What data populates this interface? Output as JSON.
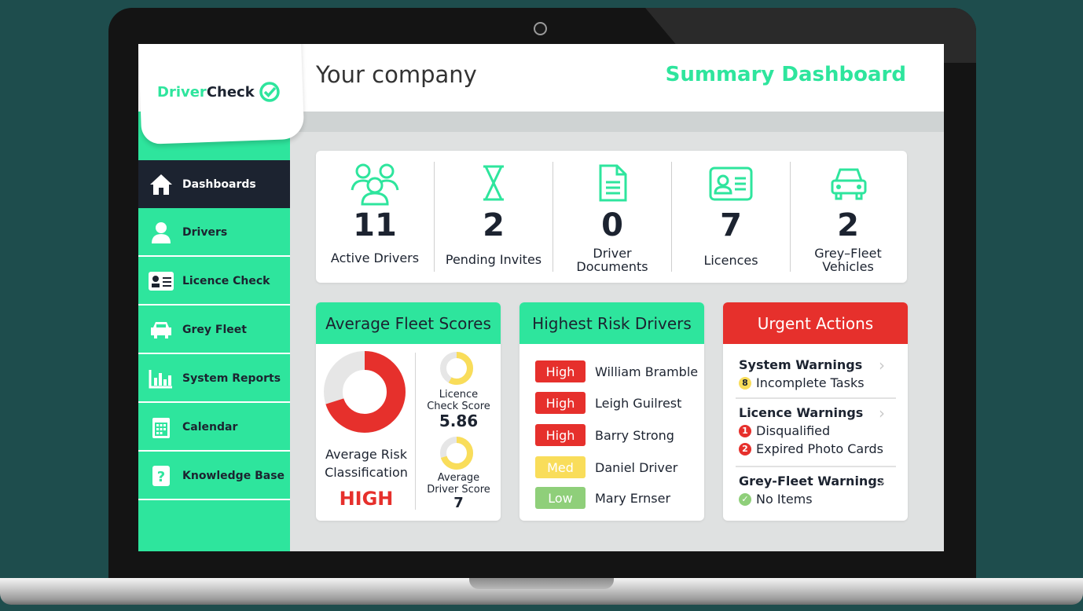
{
  "header": {
    "company": "Your company",
    "dashboard_title": "Summary Dashboard"
  },
  "brand": {
    "logo_part1": "Driver",
    "logo_part2": "Check"
  },
  "sidebar": {
    "items": [
      {
        "label": "Dashboards",
        "icon": "home-icon",
        "active": true
      },
      {
        "label": "Drivers",
        "icon": "user-icon"
      },
      {
        "label": "Licence Check",
        "icon": "id-card-icon"
      },
      {
        "label": "Grey Fleet",
        "icon": "car-icon"
      },
      {
        "label": "System Reports",
        "icon": "bar-chart-icon"
      },
      {
        "label": "Calendar",
        "icon": "calendar-icon"
      },
      {
        "label": "Knowledge Base",
        "icon": "question-icon"
      }
    ]
  },
  "stats": [
    {
      "value": "11",
      "label": "Active Drivers",
      "icon": "users-icon"
    },
    {
      "value": "2",
      "label": "Pending Invites",
      "icon": "hourglass-icon"
    },
    {
      "value": "0",
      "label1": "Driver",
      "label2": "Documents",
      "icon": "document-icon"
    },
    {
      "value": "7",
      "label": "Licences",
      "icon": "id-card-icon"
    },
    {
      "value": "2",
      "label1": "Grey–Fleet",
      "label2": "Vehicles",
      "icon": "car-icon"
    }
  ],
  "fleet": {
    "title": "Average Fleet Scores",
    "risk_label1": "Average Risk",
    "risk_label2": "Classification",
    "risk_value": "HIGH",
    "licence_label1": "Licence",
    "licence_label2": "Check Score",
    "licence_value": "5.86",
    "driver_label1": "Average",
    "driver_label2": "Driver Score",
    "driver_value": "7"
  },
  "risk": {
    "title": "Highest Risk Drivers",
    "rows": [
      {
        "level": "High",
        "name": "William Bramble"
      },
      {
        "level": "High",
        "name": "Leigh Guilrest"
      },
      {
        "level": "High",
        "name": "Barry Strong"
      },
      {
        "level": "Med",
        "name": "Daniel Driver"
      },
      {
        "level": "Low",
        "name": "Mary Ernser"
      }
    ]
  },
  "urgent": {
    "title": "Urgent Actions",
    "system_title": "System Warnings",
    "system_count": "8",
    "system_text": "Incomplete Tasks",
    "licence_title": "Licence Warnings",
    "licence_c1": "1",
    "licence_t1": "Disqualified",
    "licence_c2": "2",
    "licence_t2": "Expired Photo Cards",
    "grey_title": "Grey-Fleet Warnings",
    "grey_text": "No Items"
  },
  "colors": {
    "accent": "#2ee59d",
    "dark": "#1c2330",
    "red": "#e6302c",
    "amber": "#f9dd5a",
    "lowgreen": "#8fcf7a"
  }
}
